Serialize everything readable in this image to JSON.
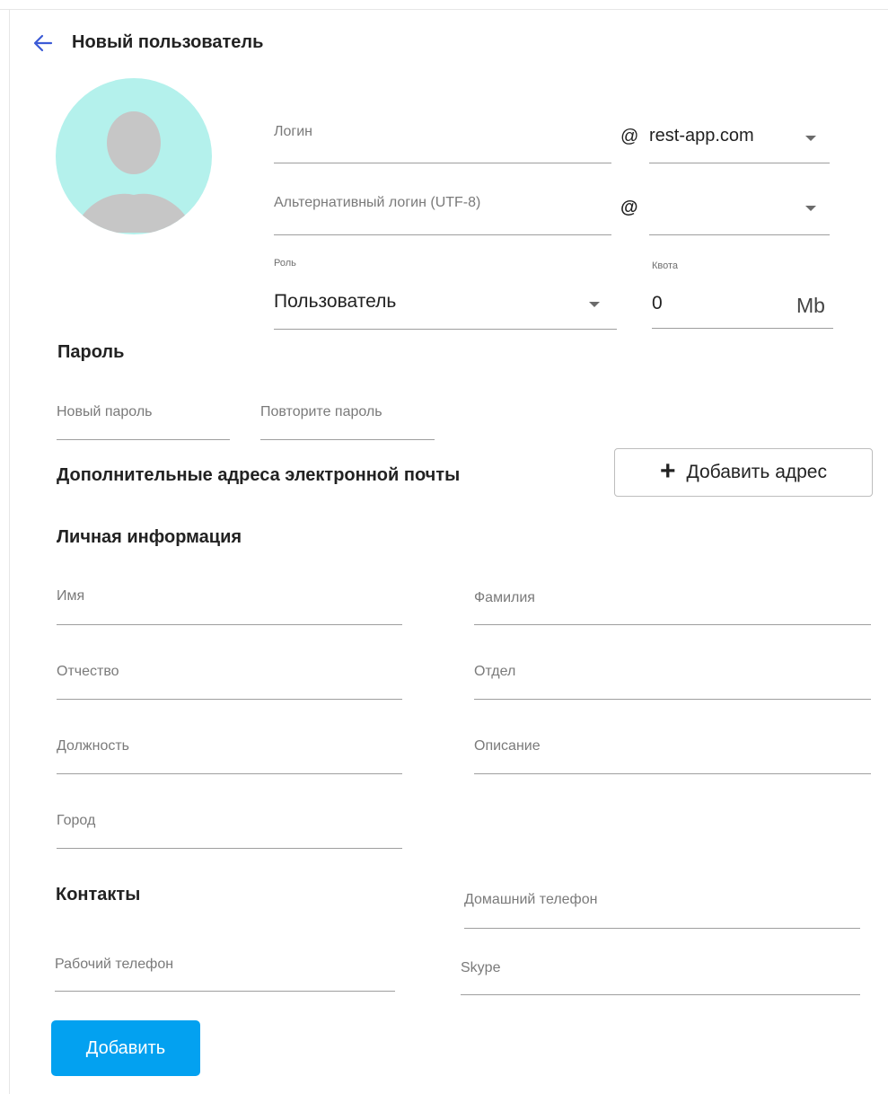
{
  "header": {
    "title": "Новый пользователь"
  },
  "account": {
    "login_label": "Логин",
    "login_at": "@",
    "domain_value": "rest-app.com",
    "alt_login_label": "Альтернативный логин (UTF-8)",
    "alt_login_at": "@",
    "alt_domain_value": "",
    "role_label": "Роль",
    "role_value": "Пользователь",
    "quota_label": "Квота",
    "quota_value": "0",
    "quota_unit": "Mb"
  },
  "password": {
    "title": "Пароль",
    "new_label": "Новый пароль",
    "repeat_label": "Повторите пароль"
  },
  "emails": {
    "title": "Дополнительные адреса электронной почты",
    "add_button_icon": "+",
    "add_button_label": "Добавить адрес"
  },
  "personal": {
    "title": "Личная информация",
    "first_name_label": "Имя",
    "last_name_label": "Фамилия",
    "middle_name_label": "Отчество",
    "department_label": "Отдел",
    "position_label": "Должность",
    "description_label": "Описание",
    "city_label": "Город"
  },
  "contacts": {
    "title": "Контакты",
    "home_phone_label": "Домашний телефон",
    "work_phone_label": "Рабочий телефон",
    "skype_label": "Skype"
  },
  "footer": {
    "submit_label": "Добавить"
  },
  "colors": {
    "accent": "#03a1f0",
    "back_arrow": "#3c5bd6",
    "avatar_bg": "#b4f1ec",
    "avatar_silhouette": "#c6c6c6"
  },
  "icons": {
    "back": "arrow-left-icon",
    "avatar": "user-silhouette-icon",
    "dropdown": "caret-down-icon",
    "add": "plus-icon"
  }
}
